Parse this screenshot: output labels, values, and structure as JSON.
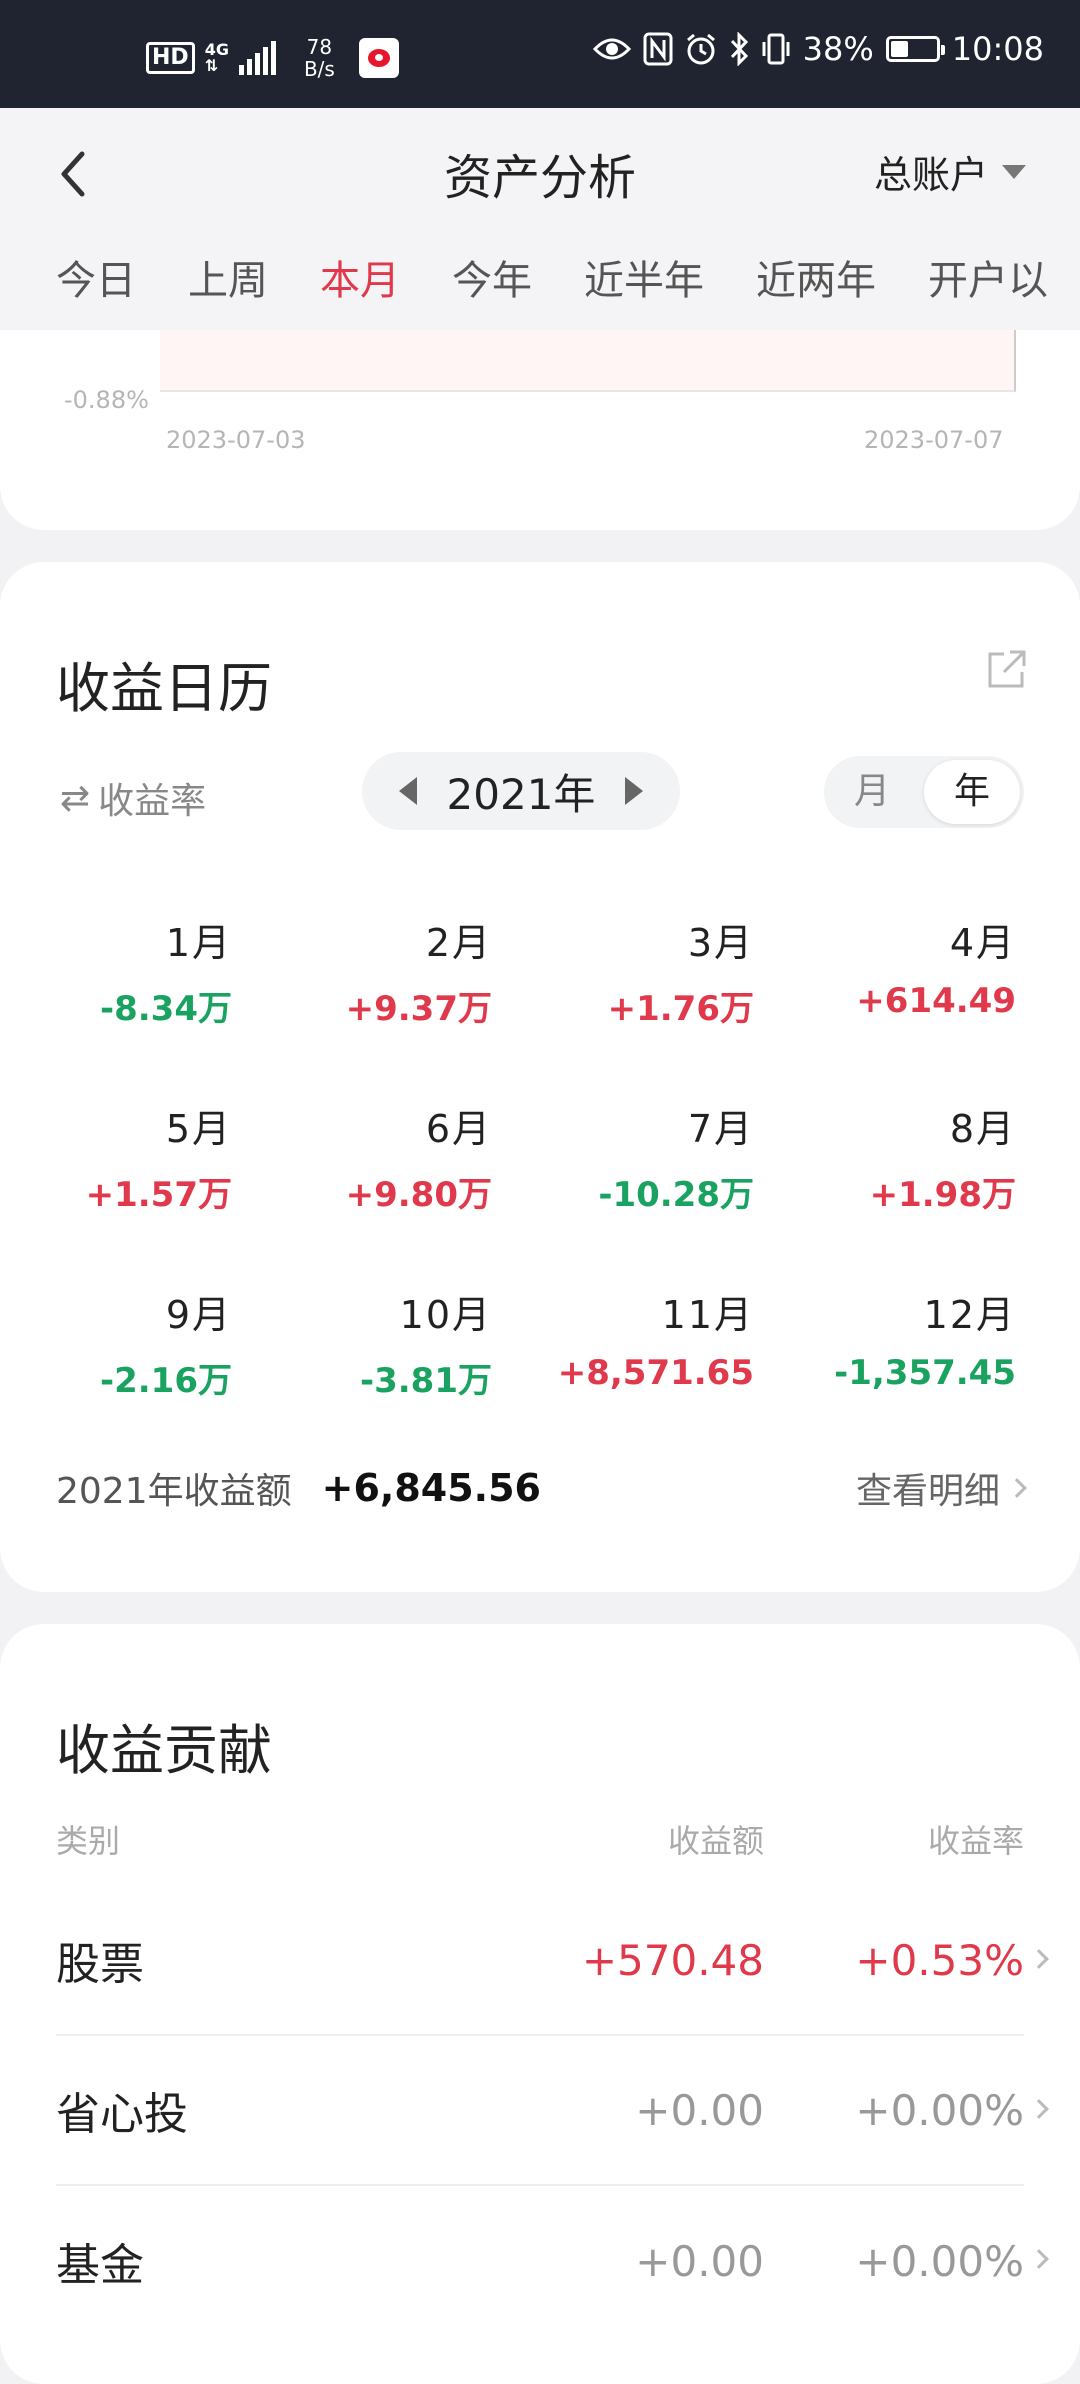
{
  "status_bar": {
    "hd": "HD",
    "network": "4G",
    "speed_value": "78",
    "speed_unit": "B/s",
    "battery": "38%",
    "time": "10:08",
    "battery_level": 0.38
  },
  "header": {
    "title": "资产分析",
    "account": "总账户",
    "tabs": [
      {
        "label": "今日"
      },
      {
        "label": "上周"
      },
      {
        "label": "本月"
      },
      {
        "label": "今年"
      },
      {
        "label": "近半年"
      },
      {
        "label": "近两年"
      },
      {
        "label": "开户以"
      }
    ],
    "active_tab": "本月"
  },
  "chart_remnant": {
    "y_label": "-0.88%",
    "x_start": "2023-07-03",
    "x_end": "2023-07-07"
  },
  "calendar": {
    "title": "收益日历",
    "ratio_toggle": "收益率",
    "year": "2021年",
    "seg_month": "月",
    "seg_year": "年",
    "months": [
      {
        "name": "1月",
        "value": "-8.34万",
        "dir": "down"
      },
      {
        "name": "2月",
        "value": "+9.37万",
        "dir": "up"
      },
      {
        "name": "3月",
        "value": "+1.76万",
        "dir": "up"
      },
      {
        "name": "4月",
        "value": "+614.49",
        "dir": "up"
      },
      {
        "name": "5月",
        "value": "+1.57万",
        "dir": "up"
      },
      {
        "name": "6月",
        "value": "+9.80万",
        "dir": "up"
      },
      {
        "name": "7月",
        "value": "-10.28万",
        "dir": "down"
      },
      {
        "name": "8月",
        "value": "+1.98万",
        "dir": "up"
      },
      {
        "name": "9月",
        "value": "-2.16万",
        "dir": "down"
      },
      {
        "name": "10月",
        "value": "-3.81万",
        "dir": "down"
      },
      {
        "name": "11月",
        "value": "+8,571.65",
        "dir": "up"
      },
      {
        "name": "12月",
        "value": "-1,357.45",
        "dir": "down"
      }
    ],
    "total_label": "2021年收益额",
    "total_value": "+6,845.56",
    "detail_link": "查看明细"
  },
  "contribution": {
    "title": "收益贡献",
    "columns": [
      "类别",
      "收益额",
      "收益率"
    ],
    "rows": [
      {
        "category": "股票",
        "amount": "+570.48",
        "rate": "+0.53%",
        "dir": "up"
      },
      {
        "category": "省心投",
        "amount": "+0.00",
        "rate": "+0.00%",
        "dir": "flat"
      },
      {
        "category": "基金",
        "amount": "+0.00",
        "rate": "+0.00%",
        "dir": "flat"
      }
    ]
  },
  "colors": {
    "up": "#e0394b",
    "down": "#1aa260",
    "active_tab": "#e0394b",
    "status_bar_bg": "#1f2430"
  }
}
